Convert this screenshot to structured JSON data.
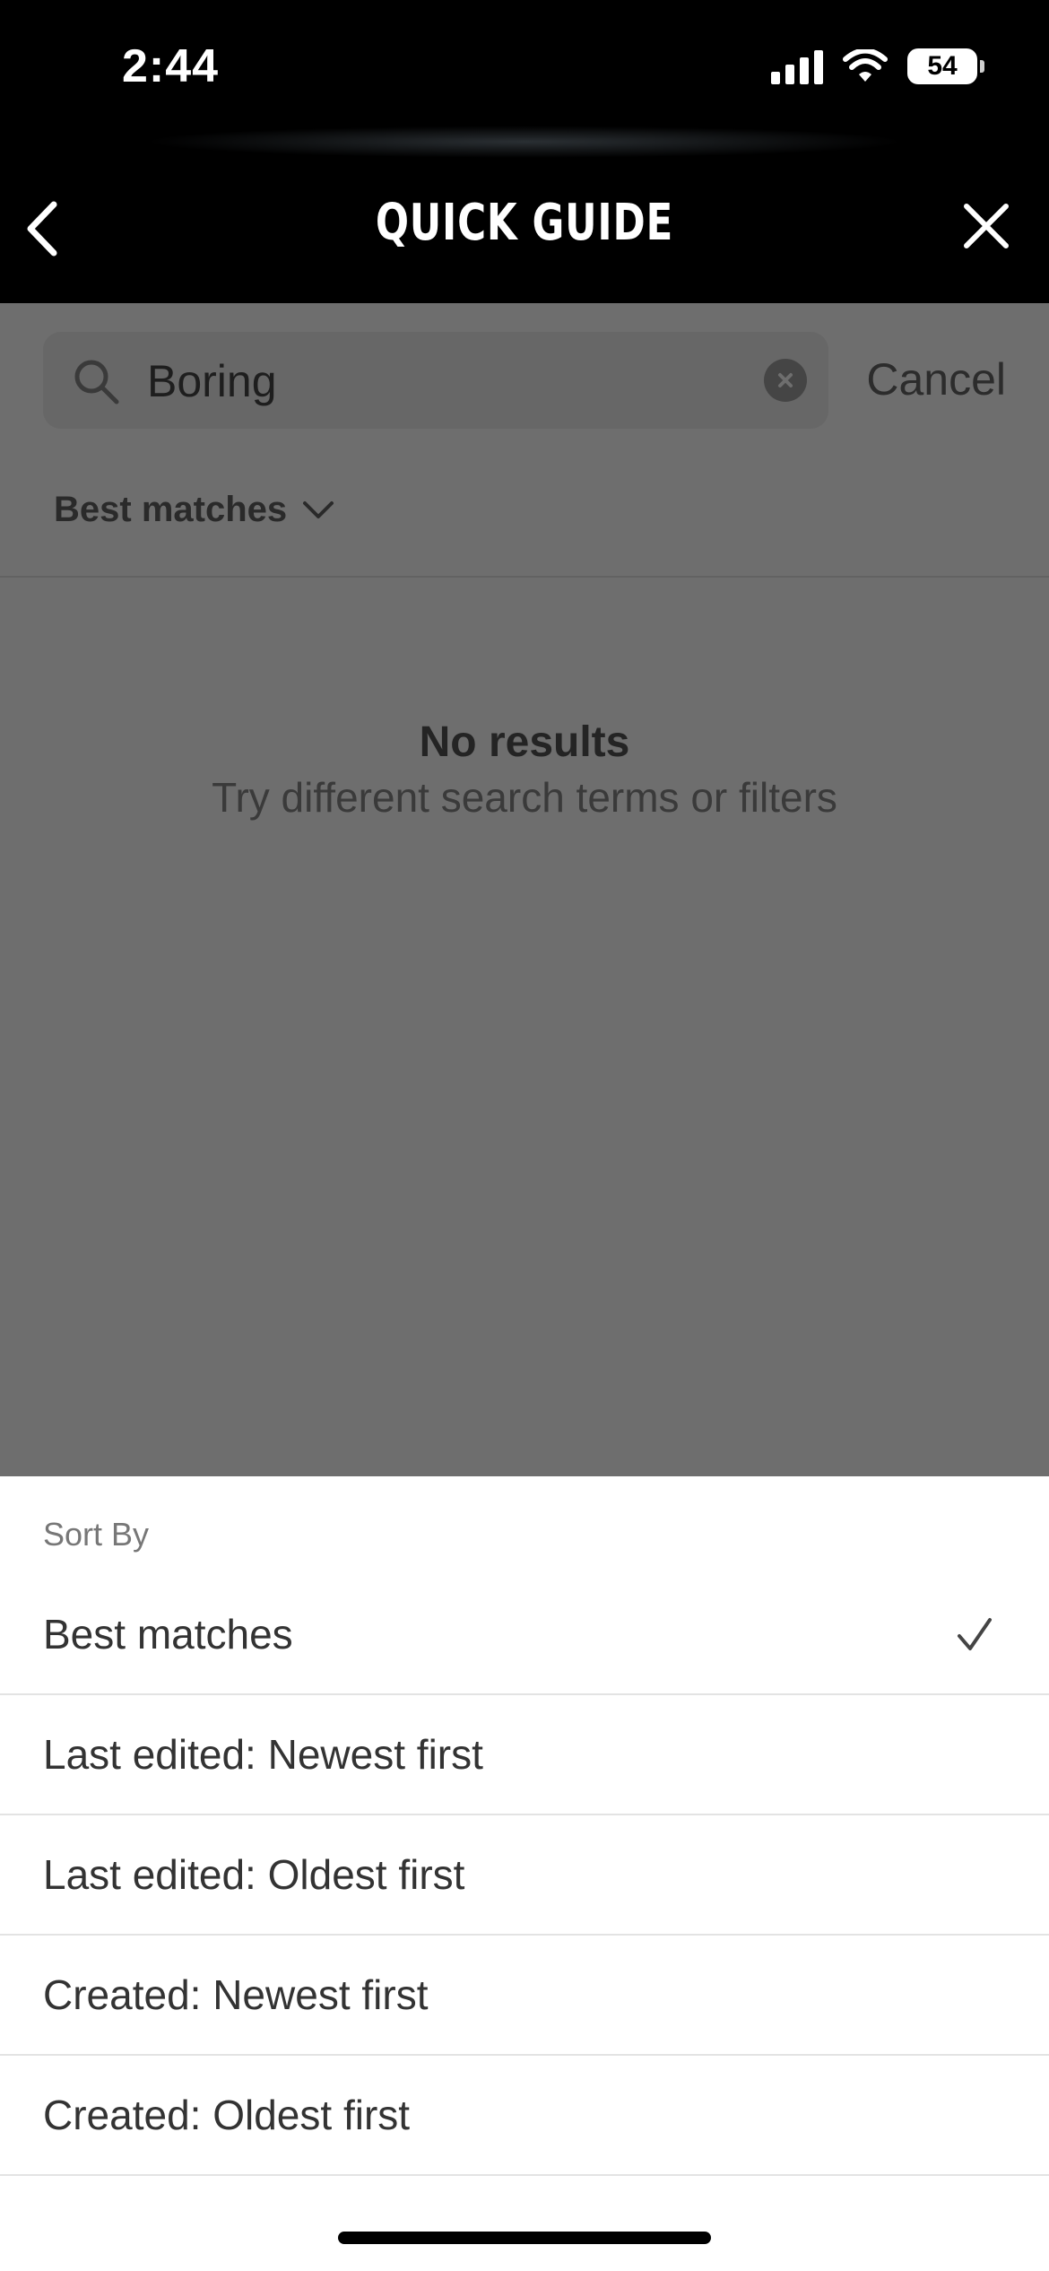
{
  "status_bar": {
    "time": "2:44",
    "battery": "54"
  },
  "header": {
    "title": "QUICK GUIDE"
  },
  "search": {
    "value": "Boring",
    "cancel_label": "Cancel"
  },
  "sort_toggle": {
    "label": "Best matches"
  },
  "empty_state": {
    "title": "No results",
    "subtitle": "Try different search terms or filters"
  },
  "sheet": {
    "title": "Sort By",
    "options": [
      {
        "label": "Best matches",
        "selected": true
      },
      {
        "label": "Last edited: Newest first",
        "selected": false
      },
      {
        "label": "Last edited: Oldest first",
        "selected": false
      },
      {
        "label": "Created: Newest first",
        "selected": false
      },
      {
        "label": "Created: Oldest first",
        "selected": false
      }
    ]
  },
  "colors": {
    "header_bg": "#000000",
    "dim_overlay": "#6e6e6e",
    "sheet_bg": "#ffffff"
  }
}
